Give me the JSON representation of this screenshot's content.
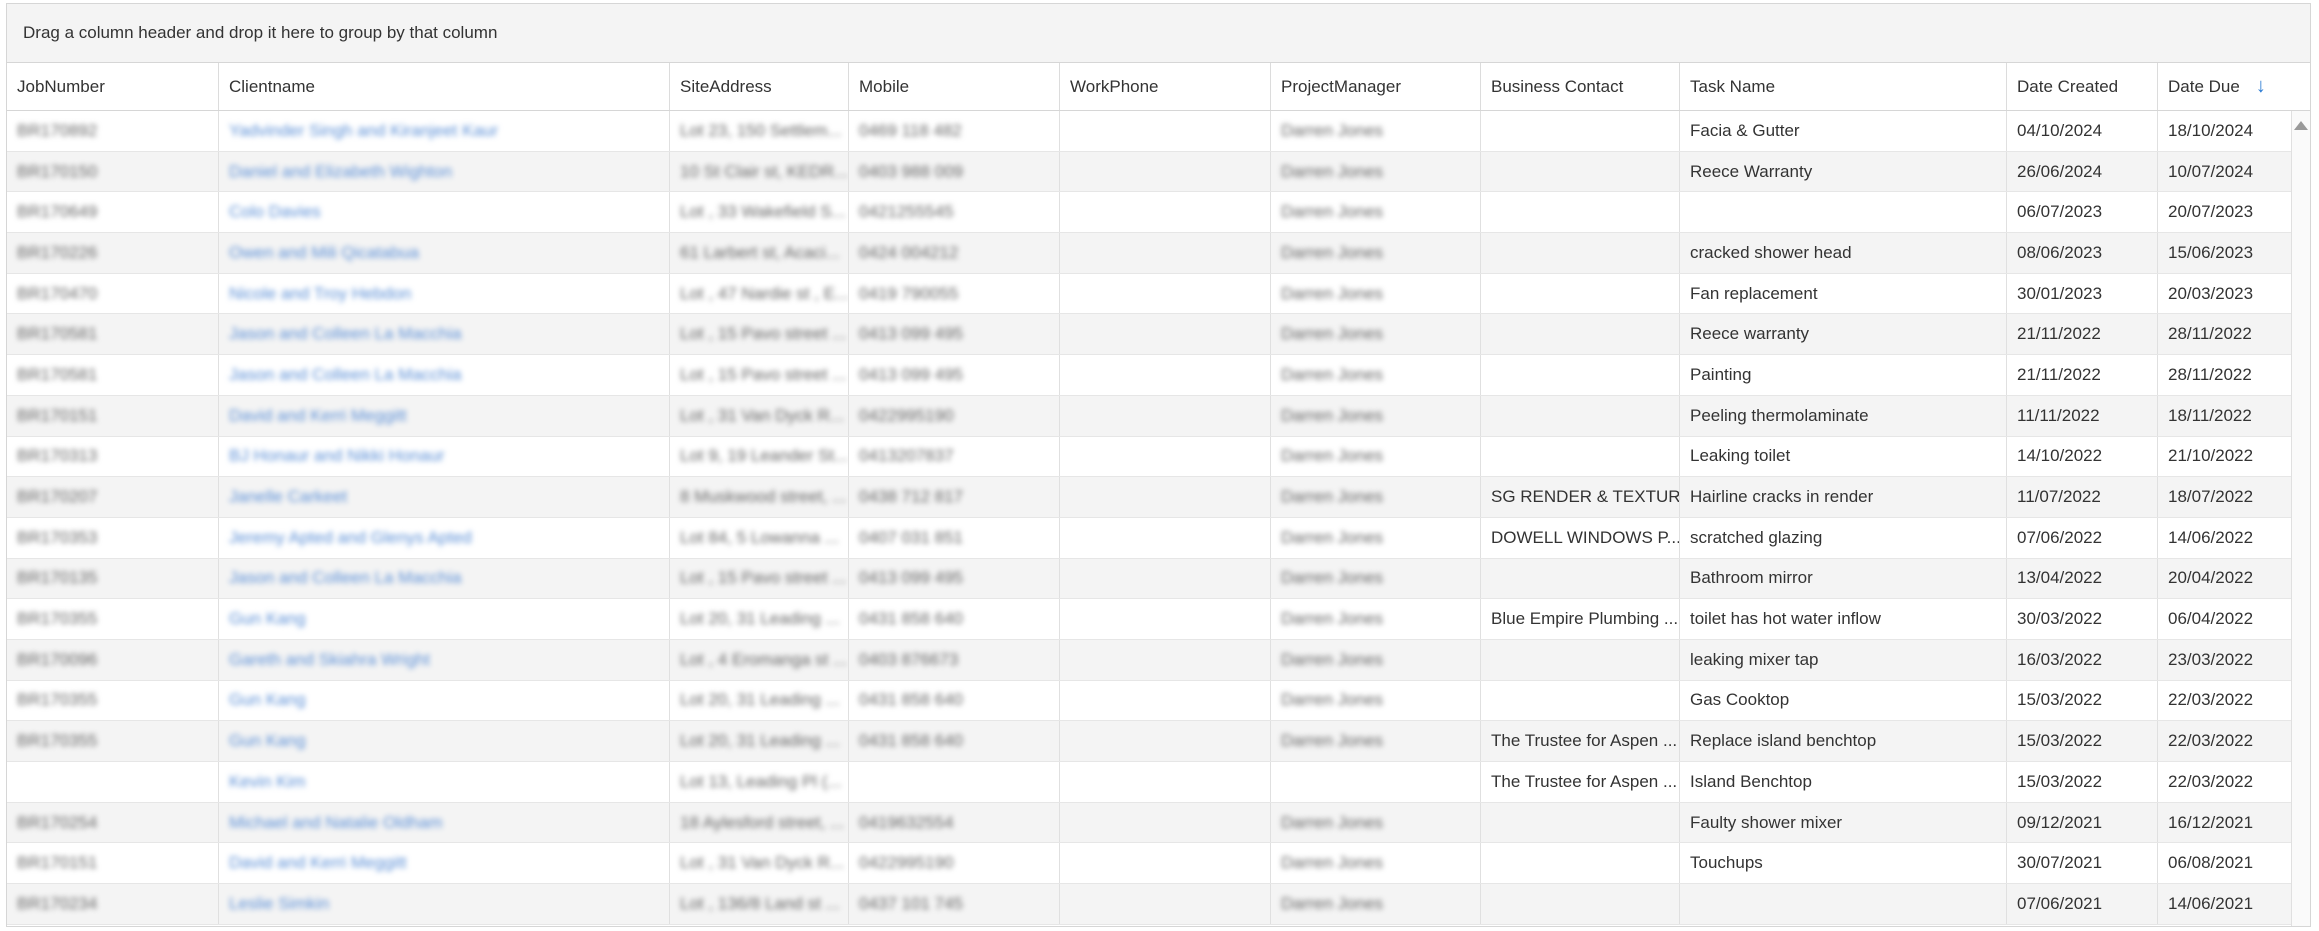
{
  "group_panel": "Drag a column header and drop it here to group by that column",
  "columns": [
    "JobNumber",
    "Clientname",
    "SiteAddress",
    "Mobile",
    "WorkPhone",
    "ProjectManager",
    "Business Contact",
    "Task Name",
    "Date Created",
    "Date Due"
  ],
  "sort": {
    "column": "Date Due",
    "direction": "descending"
  },
  "rows": [
    {
      "job": "BR170892",
      "client": "Yadvinder Singh and Kiranjeet Kaur",
      "site": "Lot 23, 150 Settlem...",
      "mobile": "0469 118 482",
      "work": "",
      "pm": "Darren Jones",
      "contact": "",
      "task": "Facia & Gutter",
      "created": "04/10/2024",
      "due": "18/10/2024"
    },
    {
      "job": "BR170150",
      "client": "Daniel and Elizabeth Wighton",
      "site": "10 St Clair st, KEDR...",
      "mobile": "0403 988 009",
      "work": "",
      "pm": "Darren Jones",
      "contact": "",
      "task": "Reece Warranty",
      "created": "26/06/2024",
      "due": "10/07/2024"
    },
    {
      "job": "BR170649",
      "client": "Colo Davies",
      "site": "Lot , 33 Wakefield S...",
      "mobile": "0421255545",
      "work": "",
      "pm": "Darren Jones",
      "contact": "",
      "task": "",
      "created": "06/07/2023",
      "due": "20/07/2023"
    },
    {
      "job": "BR170226",
      "client": "Owen and Mili Qicatabua",
      "site": "61 Larbert st, Acaci...",
      "mobile": "0424 004212",
      "work": "",
      "pm": "Darren Jones",
      "contact": "",
      "task": "cracked shower head",
      "created": "08/06/2023",
      "due": "15/06/2023"
    },
    {
      "job": "BR170470",
      "client": "Nicole and Troy Hebdon",
      "site": "Lot , 47 Nardie st , E...",
      "mobile": "0419 790055",
      "work": "",
      "pm": "Darren Jones",
      "contact": "",
      "task": "Fan replacement",
      "created": "30/01/2023",
      "due": "20/03/2023"
    },
    {
      "job": "BR170581",
      "client": "Jason and Colleen La Macchia",
      "site": "Lot , 15 Pavo street ...",
      "mobile": "0413 099 495",
      "work": "",
      "pm": "Darren Jones",
      "contact": "",
      "task": "Reece warranty",
      "created": "21/11/2022",
      "due": "28/11/2022"
    },
    {
      "job": "BR170581",
      "client": "Jason and Colleen La Macchia",
      "site": "Lot , 15 Pavo street ...",
      "mobile": "0413 099 495",
      "work": "",
      "pm": "Darren Jones",
      "contact": "",
      "task": "Painting",
      "created": "21/11/2022",
      "due": "28/11/2022"
    },
    {
      "job": "BR170151",
      "client": "David and Kerri Meggitt",
      "site": "Lot , 31 Van Dyck R...",
      "mobile": "0422995190",
      "work": "",
      "pm": "Darren Jones",
      "contact": "",
      "task": "Peeling thermolaminate",
      "created": "11/11/2022",
      "due": "18/11/2022"
    },
    {
      "job": "BR170313",
      "client": "BJ Honaur and Nikki Honaur",
      "site": "Lot 9, 19 Leander St...",
      "mobile": "0413207837",
      "work": "",
      "pm": "Darren Jones",
      "contact": "",
      "task": "Leaking toilet",
      "created": "14/10/2022",
      "due": "21/10/2022"
    },
    {
      "job": "BR170207",
      "client": "Janelle Carkeet",
      "site": "8 Muskwood street, ...",
      "mobile": "0438 712 817",
      "work": "",
      "pm": "Darren Jones",
      "contact": "SG RENDER & TEXTUR...",
      "task": "Hairline cracks in render",
      "created": "11/07/2022",
      "due": "18/07/2022"
    },
    {
      "job": "BR170353",
      "client": "Jeremy Apted and Glenys Apted",
      "site": "Lot 84, 5 Lowanna ...",
      "mobile": "0407 031 851",
      "work": "",
      "pm": "Darren Jones",
      "contact": "DOWELL WINDOWS P...",
      "task": "scratched glazing",
      "created": "07/06/2022",
      "due": "14/06/2022"
    },
    {
      "job": "BR170135",
      "client": "Jason and Colleen La Macchia",
      "site": "Lot , 15 Pavo street ...",
      "mobile": "0413 099 495",
      "work": "",
      "pm": "Darren Jones",
      "contact": "",
      "task": "Bathroom mirror",
      "created": "13/04/2022",
      "due": "20/04/2022"
    },
    {
      "job": "BR170355",
      "client": "Gun Kang",
      "site": "Lot 20, 31 Leading ...",
      "mobile": "0431 858 640",
      "work": "",
      "pm": "Darren Jones",
      "contact": "Blue Empire Plumbing ...",
      "task": "toilet has hot water inflow",
      "created": "30/03/2022",
      "due": "06/04/2022"
    },
    {
      "job": "BR170096",
      "client": "Gareth and Skiahra Wright",
      "site": "Lot , 4 Eromanga st ...",
      "mobile": "0403 876673",
      "work": "",
      "pm": "Darren Jones",
      "contact": "",
      "task": "leaking mixer tap",
      "created": "16/03/2022",
      "due": "23/03/2022"
    },
    {
      "job": "BR170355",
      "client": "Gun Kang",
      "site": "Lot 20, 31 Leading ...",
      "mobile": "0431 858 640",
      "work": "",
      "pm": "Darren Jones",
      "contact": "",
      "task": "Gas Cooktop",
      "created": "15/03/2022",
      "due": "22/03/2022"
    },
    {
      "job": "BR170355",
      "client": "Gun Kang",
      "site": "Lot 20, 31 Leading ...",
      "mobile": "0431 858 640",
      "work": "",
      "pm": "Darren Jones",
      "contact": "The Trustee for Aspen ...",
      "task": "Replace island benchtop",
      "created": "15/03/2022",
      "due": "22/03/2022"
    },
    {
      "job": "",
      "client": "Kevin Kim",
      "site": "Lot 13, Leading Pl (...",
      "mobile": "",
      "work": "",
      "pm": "",
      "contact": "The Trustee for Aspen ...",
      "task": "Island Benchtop",
      "created": "15/03/2022",
      "due": "22/03/2022"
    },
    {
      "job": "BR170254",
      "client": "Michael and Natalie Oldham",
      "site": "18 Aylesford street, ...",
      "mobile": "0419632554",
      "work": "",
      "pm": "Darren Jones",
      "contact": "",
      "task": "Faulty shower mixer",
      "created": "09/12/2021",
      "due": "16/12/2021"
    },
    {
      "job": "BR170151",
      "client": "David and Kerri Meggitt",
      "site": "Lot , 31 Van Dyck R...",
      "mobile": "0422995190",
      "work": "",
      "pm": "Darren Jones",
      "contact": "",
      "task": "Touchups",
      "created": "30/07/2021",
      "due": "06/08/2021"
    },
    {
      "job": "BR170234",
      "client": "Leslie Simkin",
      "site": "Lot , 136/8 Land st ...",
      "mobile": "0437 101 745",
      "work": "",
      "pm": "Darren Jones",
      "contact": "",
      "task": "",
      "created": "07/06/2021",
      "due": "14/06/2021"
    }
  ]
}
